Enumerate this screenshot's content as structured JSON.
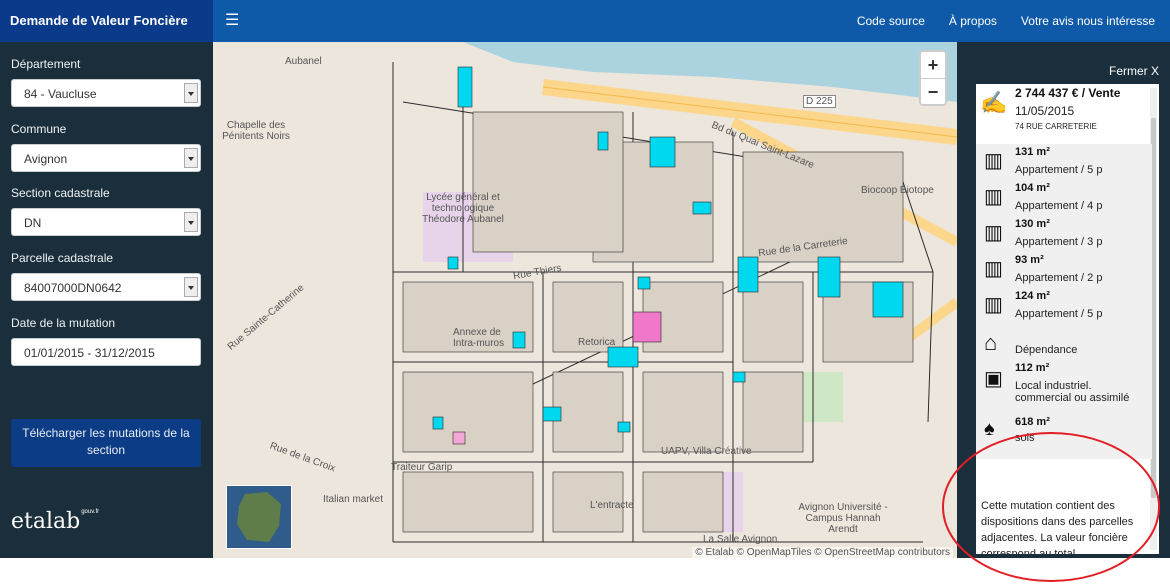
{
  "app": {
    "title": "Demande de Valeur Foncière",
    "nav": [
      "Code source",
      "À propos",
      "Votre avis nous intéresse"
    ]
  },
  "sidebar": {
    "fields": [
      {
        "label": "Département",
        "value": "84 - Vaucluse"
      },
      {
        "label": "Commune",
        "value": "Avignon"
      },
      {
        "label": "Section cadastrale",
        "value": "DN"
      },
      {
        "label": "Parcelle cadastrale",
        "value": "84007000DN0642"
      }
    ],
    "date_label": "Date de la mutation",
    "date_value": "01/01/2015 - 31/12/2015",
    "download_label": "Télécharger les mutations de la section",
    "logo_text": "etalab",
    "logo_sup": "gouv.fr"
  },
  "map": {
    "zoom_in": "+",
    "zoom_out": "−",
    "attribution": "© Etalab © OpenMapTiles © OpenStreetMap contributors",
    "labels": [
      "Aubanel",
      "Chapelle des Pénitents Noirs",
      "Lycée général et technologique Théodore Aubanel",
      "Rue Sainte-Catherine",
      "Rue de la Croix",
      "Traiteur Garip",
      "Italian market",
      "L'entracte",
      "UAPV, Villa Créative",
      "Avignon Université - Campus Hannah Arendt",
      "La Salle Avignon",
      "Bd du Quai Saint-Lazare",
      "Rue de la Carreterie",
      "D 225",
      "Biocoop Biotope",
      "Annexe de Intra-muros",
      "Rue Thiers",
      "Retorica"
    ]
  },
  "panel": {
    "close": "Fermer X",
    "price": "2 744 437 € / Vente",
    "date": "11/05/2015",
    "address": "74 RUE CARRETERIE",
    "lots": [
      {
        "surface": "131 m²",
        "type": "Appartement / 5 p",
        "icon": "building-icon"
      },
      {
        "surface": "104 m²",
        "type": "Appartement / 4 p",
        "icon": "building-icon"
      },
      {
        "surface": "130 m²",
        "type": "Appartement / 3 p",
        "icon": "building-icon"
      },
      {
        "surface": "93 m²",
        "type": "Appartement / 2 p",
        "icon": "building-icon"
      },
      {
        "surface": "124 m²",
        "type": "Appartement / 5 p",
        "icon": "building-icon"
      },
      {
        "surface": "",
        "type": "Dépendance",
        "icon": "garage-icon"
      },
      {
        "surface": "112 m²",
        "type": "Local industriel. commercial ou assimilé",
        "icon": "shop-icon"
      },
      {
        "surface": "618 m²",
        "type": "sols",
        "icon": "tree-icon"
      }
    ],
    "note": "Cette mutation contient des dispositions dans des parcelles adjacentes. La valeur foncière correspond au total."
  },
  "colors": {
    "topbar": "#0f5aa8",
    "brand": "#0b3a8a",
    "sidebar": "#1a2f3b",
    "highlight": "#e31e24",
    "parcel_sold": "#00d8f0"
  }
}
